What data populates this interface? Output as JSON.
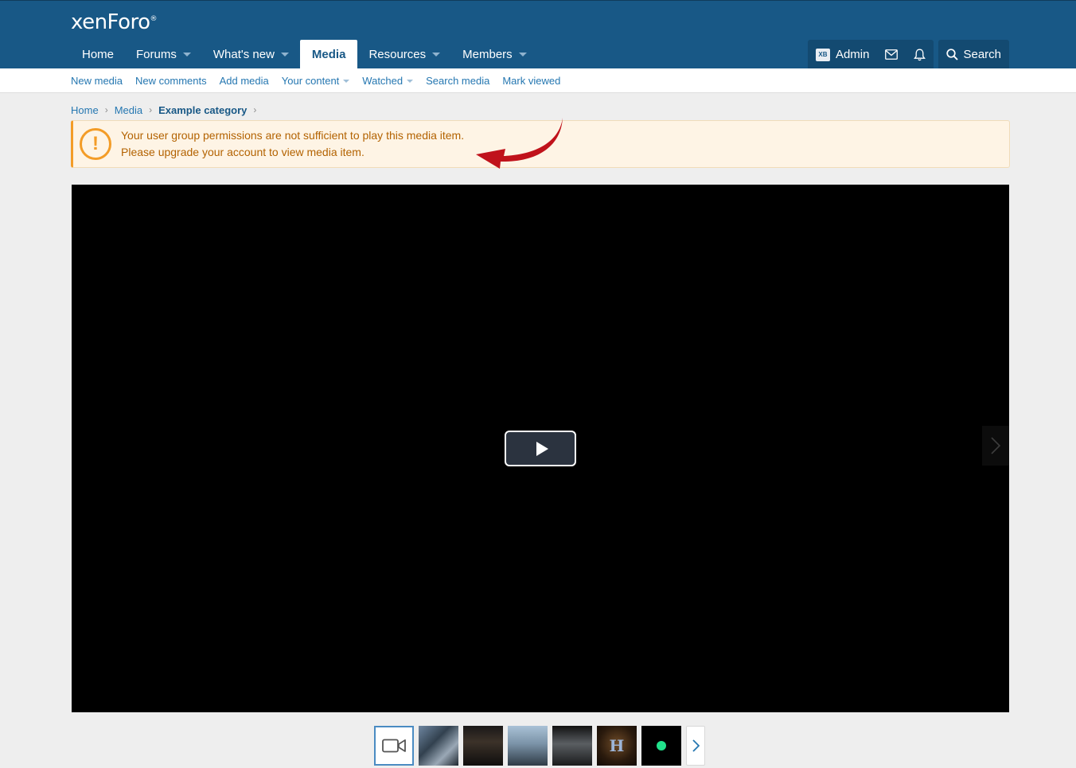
{
  "header": {
    "logo_text": "xenForo",
    "logo_mark": "®",
    "nav": [
      {
        "label": "Home"
      },
      {
        "label": "Forums"
      },
      {
        "label": "What's new"
      },
      {
        "label": "Media"
      },
      {
        "label": "Resources"
      },
      {
        "label": "Members"
      }
    ],
    "active_tab": "Media",
    "user": {
      "avatar_text": "XB",
      "name": "Admin"
    },
    "search_label": "Search"
  },
  "subnav": {
    "items": [
      {
        "label": "New media"
      },
      {
        "label": "New comments"
      },
      {
        "label": "Add media"
      },
      {
        "label": "Your content"
      },
      {
        "label": "Watched"
      },
      {
        "label": "Search media"
      },
      {
        "label": "Mark viewed"
      }
    ]
  },
  "breadcrumb": {
    "items": [
      {
        "label": "Home"
      },
      {
        "label": "Media"
      },
      {
        "label": "Example category"
      }
    ]
  },
  "notice": {
    "line1": "Your user group permissions are not sufficient to play this media item.",
    "line2": "Please upgrade your account to view media item."
  },
  "filmstrip": {
    "thumb5_text": "H"
  },
  "colors": {
    "header_bg": "#185886",
    "link": "#2577b1",
    "notice_bg": "#fef4e5",
    "notice_accent": "#f39c27",
    "annotation_arrow": "#c0121b"
  }
}
